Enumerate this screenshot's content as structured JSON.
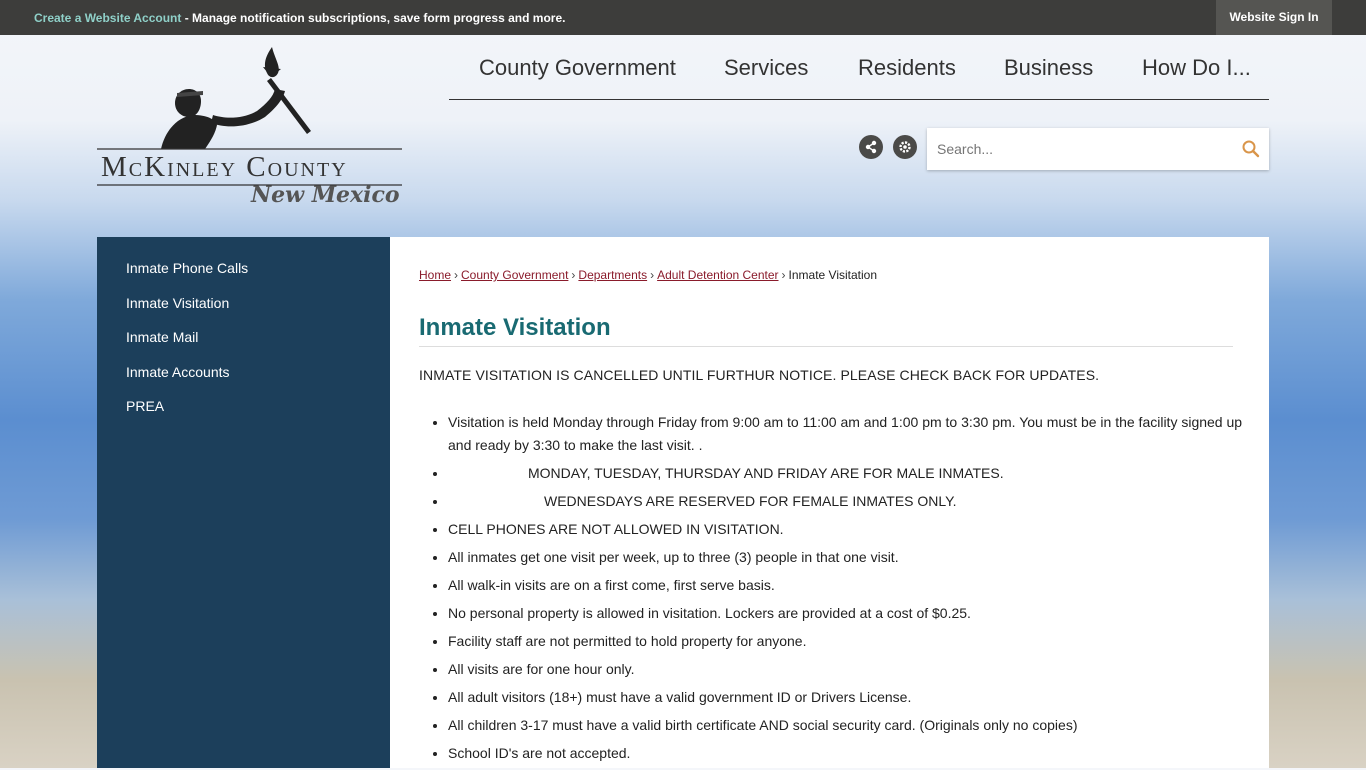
{
  "topbar": {
    "account_link": "Create a Website Account",
    "message": " - Manage notification subscriptions, save form progress and more.",
    "signin": "Website Sign In"
  },
  "logo": {
    "line1": "McKinley County",
    "line2": "New Mexico"
  },
  "nav": {
    "items": [
      "County Government",
      "Services",
      "Residents",
      "Business",
      "How Do I..."
    ]
  },
  "tools": {
    "share_icon": "share-icon",
    "settings_icon": "gear-icon"
  },
  "search": {
    "placeholder": "Search..."
  },
  "sidebar": {
    "items": [
      "Inmate Phone Calls",
      "Inmate Visitation",
      "Inmate Mail",
      "Inmate Accounts",
      "PREA"
    ]
  },
  "breadcrumb": {
    "items": [
      "Home",
      "County Government",
      "Departments",
      "Adult Detention Center"
    ],
    "current": "Inmate Visitation"
  },
  "page": {
    "title": "Inmate Visitation",
    "notice": "INMATE VISITATION IS CANCELLED UNTIL FURTHUR NOTICE.  PLEASE CHECK BACK FOR UPDATES.",
    "rules": [
      "Visitation is held Monday through Friday from 9:00 am to 11:00 am and 1:00 pm to 3:30 pm.  You must be in the facility signed up and ready by 3:30 to make the last visit.  .",
      "MONDAY, TUESDAY, THURSDAY AND FRIDAY ARE FOR MALE INMATES.",
      "WEDNESDAYS ARE RESERVED FOR FEMALE INMATES ONLY.",
      "CELL PHONES ARE NOT ALLOWED IN VISITATION.",
      "All inmates get one visit per week, up to three (3) people in that one visit.",
      "All walk-in visits are on a first come, first serve basis.",
      "No personal property is allowed in visitation. Lockers are provided at a cost of $0.25.",
      "Facility staff are not permitted to hold property for anyone.",
      "All visits are for one hour only.",
      "All adult visitors (18+) must have a valid government ID or Drivers License.",
      "All children 3-17 must have a valid birth certificate AND social security card.  (Originals only no copies)",
      "School ID's are not accepted."
    ]
  }
}
